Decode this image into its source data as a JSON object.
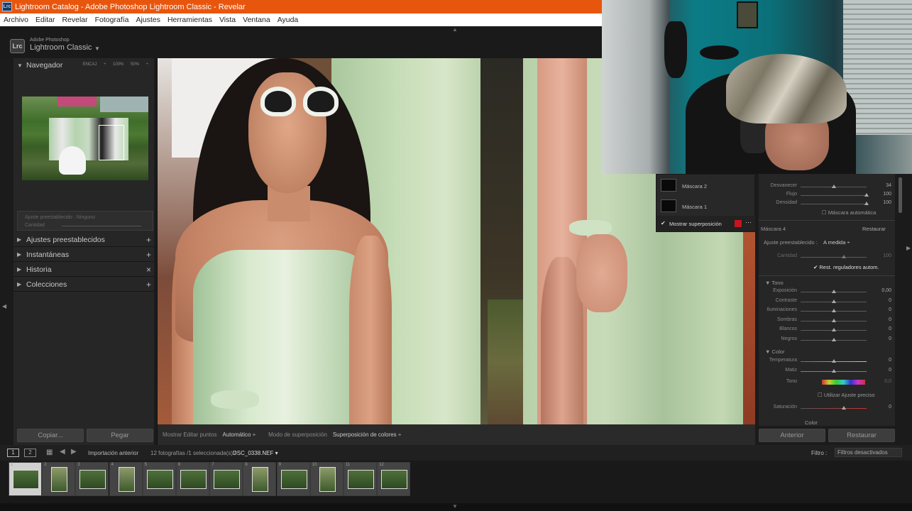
{
  "window": {
    "title": "Lightroom Catalog - Adobe Photoshop Lightroom Classic - Revelar",
    "app_icon": "Lrc"
  },
  "menu": [
    "Archivo",
    "Editar",
    "Revelar",
    "Fotografía",
    "Ajustes",
    "Herramientas",
    "Vista",
    "Ventana",
    "Ayuda"
  ],
  "identity": {
    "badge": "Lrc",
    "small": "Adobe Photoshop",
    "big": "Lightroom Classic"
  },
  "left_panel": {
    "navigator": {
      "title": "Navegador",
      "zoom_options": "ENCAJ ÷ 100% 50% ÷"
    },
    "preset": {
      "line1": "Ajuste preestablecido : Ninguno",
      "line2": "Cantidad"
    },
    "sections": [
      {
        "label": "Ajustes preestablecidos",
        "action": "+"
      },
      {
        "label": "Instantáneas",
        "action": "+"
      },
      {
        "label": "Historia",
        "action": "×"
      },
      {
        "label": "Colecciones",
        "action": "+"
      }
    ],
    "buttons": {
      "copy": "Copiar...",
      "paste": "Pegar"
    }
  },
  "toolbar": {
    "show_edit_pins": "Mostrar Editar puntos",
    "edit_pins_value": "Automático ÷",
    "overlay_mode": "Modo de superposición",
    "overlay_value": "Superposición de colores ÷"
  },
  "mask_panel": {
    "items": [
      {
        "name": "Máscara 2"
      },
      {
        "name": "Máscara 1"
      }
    ],
    "show_overlay": "Mostrar superposición",
    "overlay_color": "#c8141e"
  },
  "right_panel": {
    "brush": [
      {
        "label": "Desvanecer",
        "value": "34",
        "pos": 0.5
      },
      {
        "label": "Flujo",
        "value": "100",
        "pos": 1.0
      },
      {
        "label": "Densidad",
        "value": "100",
        "pos": 1.0
      }
    ],
    "auto_mask": "Máscara automática",
    "mask_header": "Máscara 4",
    "restore": "Restaurar",
    "preset_label": "Ajuste preestablecido :",
    "preset_value": "A medida ÷",
    "amount_label": "Cantidad",
    "amount_value": "100",
    "reset_sliders": "Rest. reguladores autom.",
    "tone": {
      "title": "Tono",
      "sliders": [
        {
          "label": "Exposición",
          "value": "0,00"
        },
        {
          "label": "Contraste",
          "value": "0"
        },
        {
          "label": "Iluminaciones",
          "value": "0"
        },
        {
          "label": "Sombras",
          "value": "0"
        },
        {
          "label": "Blancos",
          "value": "0"
        },
        {
          "label": "Negros",
          "value": "0"
        }
      ]
    },
    "color": {
      "title": "Color",
      "sliders": [
        {
          "label": "Temperatura",
          "value": "0"
        },
        {
          "label": "Matiz",
          "value": "0"
        }
      ],
      "hue_label": "Tono",
      "hue_value": "0,0",
      "fine": "Utilizar Ajuste preciso",
      "saturation_label": "Saturación",
      "saturation_value": "0",
      "color_label": "Color"
    },
    "buttons": {
      "previous": "Anterior",
      "reset": "Restaurar"
    }
  },
  "filmstrip_bar": {
    "view1": "1",
    "view2": "2",
    "source": "Importación anterior",
    "count": "12 fotografías /1 seleccionada(s) /",
    "filename": "DSC_0338.NEF ▾",
    "filter_label": "Filtro :",
    "filter_value": "Filtros desactivados"
  },
  "filmstrip": [
    {
      "n": "1",
      "tall": false,
      "selected": true
    },
    {
      "n": "2",
      "tall": true,
      "selected": false
    },
    {
      "n": "3",
      "tall": false,
      "selected": false
    },
    {
      "n": "4",
      "tall": true,
      "selected": false
    },
    {
      "n": "5",
      "tall": false,
      "selected": false
    },
    {
      "n": "6",
      "tall": false,
      "selected": false
    },
    {
      "n": "7",
      "tall": false,
      "selected": false
    },
    {
      "n": "8",
      "tall": true,
      "selected": false
    },
    {
      "n": "9",
      "tall": false,
      "selected": false
    },
    {
      "n": "10",
      "tall": true,
      "selected": false
    },
    {
      "n": "11",
      "tall": false,
      "selected": false
    },
    {
      "n": "12",
      "tall": false,
      "selected": false
    }
  ]
}
